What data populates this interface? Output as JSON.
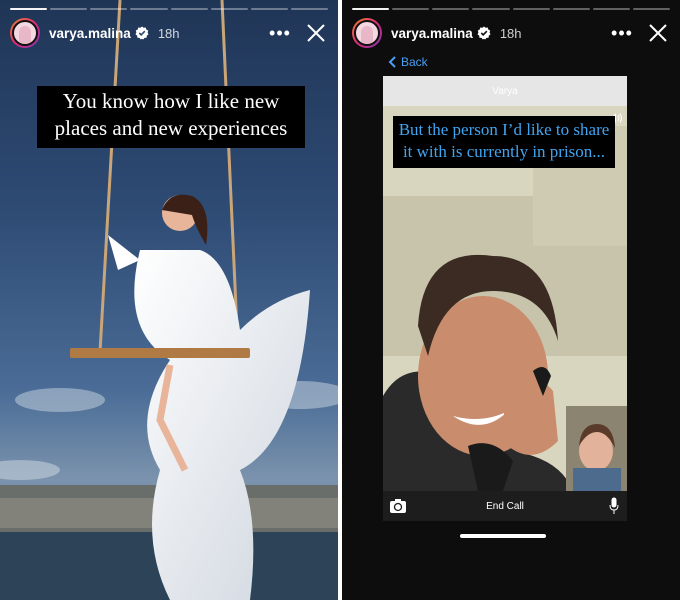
{
  "stories": [
    {
      "username": "varya.malina",
      "time": "18h",
      "caption": "You know how I like new places and new experiences",
      "progress": {
        "segments": 8,
        "viewed": 1
      }
    },
    {
      "username": "varya.malina",
      "time": "18h",
      "back_label": "Back",
      "caption": "But the person I’d like to share it with is currently in prison...",
      "call": {
        "caller_name": "Varya",
        "end_call_label": "End Call"
      },
      "progress": {
        "segments": 8,
        "viewed": 1
      }
    }
  ],
  "colors": {
    "link_blue": "#4b9df5",
    "caption_blue": "#41a4ef",
    "verified_blue": "#3897f0"
  }
}
